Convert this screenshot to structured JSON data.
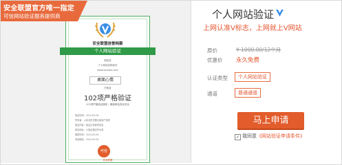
{
  "ribbon": {
    "line1": "安全联盟官方唯一指定",
    "line2": "可信网站验证服务提供商"
  },
  "certificate": {
    "org": "安全联盟信誉档案",
    "banner": "个人网站验证",
    "line_a": "网站名",
    "line_b": "个人网站名称标识",
    "line_c": "www.sample.com",
    "site_name": "桌面心情",
    "line_d": "已验证",
    "count": "102项严格验证",
    "count_caption": "102项严格验证服务，确保网站真实安全",
    "info_rows": [
      "验证时间：2014-05-09",
      "所有者：以实名形式展示给用户查看",
      "验证内容：验证主体身份信息",
      "网站地址：以验证通过时为准",
      "更新时间：2014-05-09",
      "有效期至：2015-05-09"
    ],
    "seal_text": "可信",
    "seal_label": "安全联盟"
  },
  "product": {
    "title": "个人网站验证",
    "badge": "V",
    "subtitle": "上网认准V标志，上网就上V网站",
    "price_label": "原价",
    "price_value": "¥ 1000.00/12个月",
    "promo_label": "优惠价",
    "promo_value": "永久免费",
    "type_label": "认证类型",
    "type_option": "个人网站验证",
    "channel_label": "通道",
    "channel_option": "普通通道",
    "apply_label": "马上申请",
    "agree_prefix": "我同意",
    "agree_link": "《网站验证申请条件》"
  },
  "colors": {
    "accent": "#e4542d",
    "button": "#e25c2c",
    "cert_green": "#2f9a47",
    "badge_blue": "#3a8ee6"
  }
}
